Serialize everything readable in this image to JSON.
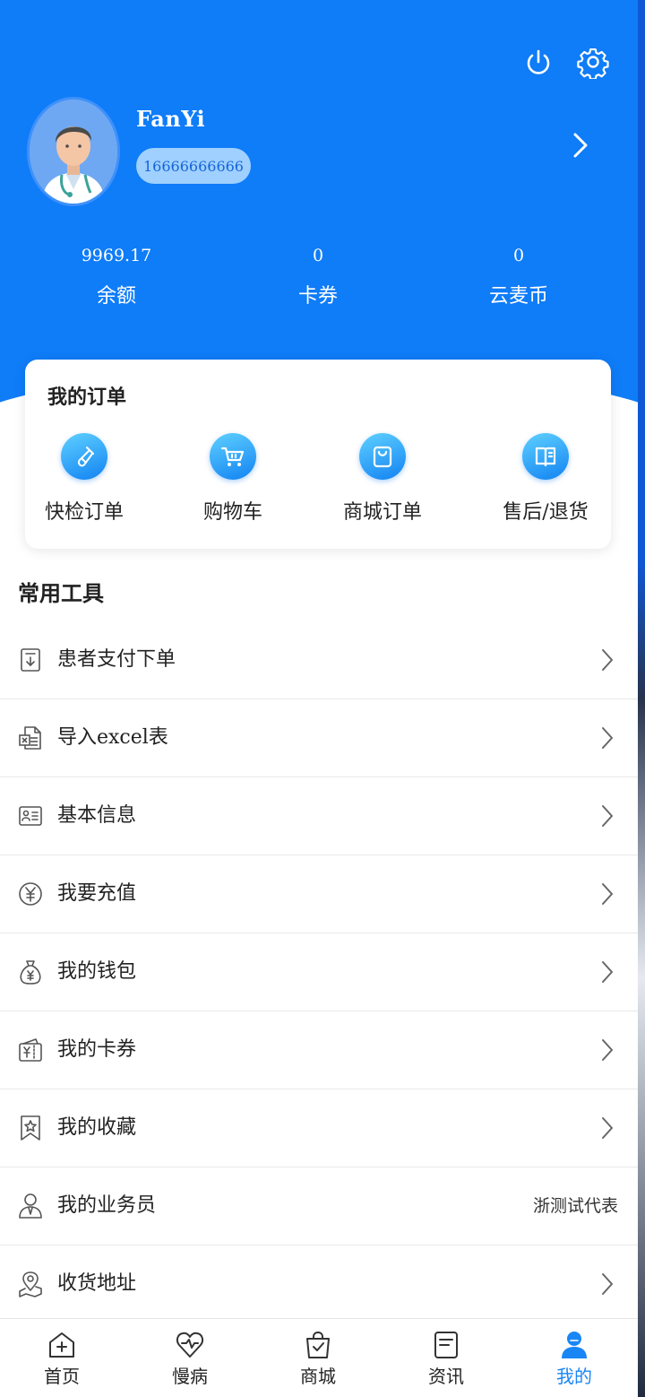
{
  "header": {
    "power_icon": "power-icon",
    "settings_icon": "gear-icon",
    "user_name": "FanYi",
    "phone": "16666666666"
  },
  "stats": [
    {
      "value": "9969.17",
      "label": "余额"
    },
    {
      "value": "0",
      "label": "卡券"
    },
    {
      "value": "0",
      "label": "云麦币"
    }
  ],
  "orders": {
    "title": "我的订单",
    "items": [
      {
        "label": "快检订单",
        "icon": "test-tube-icon"
      },
      {
        "label": "购物车",
        "icon": "cart-icon"
      },
      {
        "label": "商城订单",
        "icon": "shopping-bag-icon"
      },
      {
        "label": "售后/退货",
        "icon": "book-icon"
      }
    ]
  },
  "tools": {
    "title": "常用工具",
    "items": [
      {
        "label": "患者支付下单",
        "icon": "document-download-icon"
      },
      {
        "label": "导入excel表",
        "icon": "excel-file-icon"
      },
      {
        "label": "基本信息",
        "icon": "id-card-icon"
      },
      {
        "label": "我要充值",
        "icon": "yuan-coin-icon"
      },
      {
        "label": "我的钱包",
        "icon": "money-bag-icon"
      },
      {
        "label": "我的卡券",
        "icon": "coupon-icon"
      },
      {
        "label": "我的收藏",
        "icon": "bookmark-star-icon"
      },
      {
        "label": "我的业务员",
        "icon": "salesperson-icon",
        "value": "浙测试代表"
      },
      {
        "label": "收货地址",
        "icon": "map-pin-icon"
      }
    ]
  },
  "tabbar": {
    "items": [
      {
        "label": "首页",
        "icon": "home-plus-icon"
      },
      {
        "label": "慢病",
        "icon": "heart-pulse-icon"
      },
      {
        "label": "商城",
        "icon": "bag-check-icon"
      },
      {
        "label": "资讯",
        "icon": "news-icon"
      },
      {
        "label": "我的",
        "icon": "user-icon"
      }
    ],
    "active_index": 4
  },
  "colors": {
    "primary": "#0f7cf8",
    "active_tab": "#1a86f5",
    "phone_badge_bg": "#9fd0ff"
  }
}
